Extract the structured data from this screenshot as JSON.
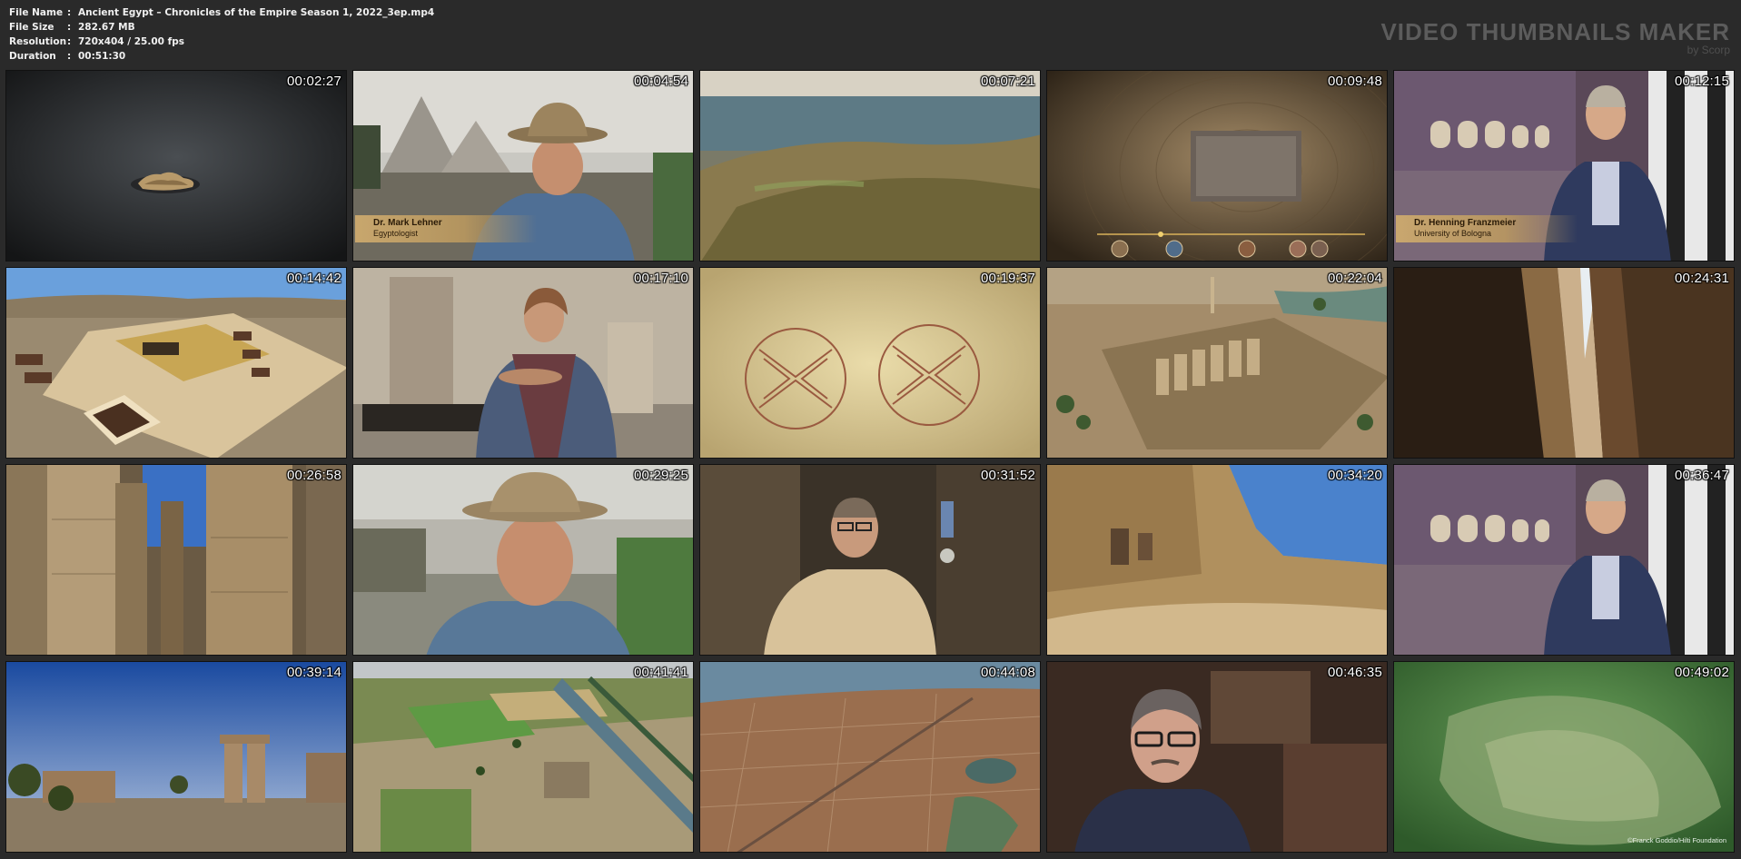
{
  "file_info": [
    {
      "key": "File Name",
      "sep": ":",
      "value": "Ancient Egypt – Chronicles of the Empire Season 1, 2022_3ep.mp4"
    },
    {
      "key": "File Size",
      "sep": ":",
      "value": "282.67 MB"
    },
    {
      "key": "Resolution",
      "sep": ":",
      "value": "720x404 / 25.00 fps"
    },
    {
      "key": "Duration",
      "sep": ":",
      "value": "00:51:30"
    }
  ],
  "brand": {
    "title": "VIDEO THUMBNAILS MAKER",
    "subtitle": "by Scorp"
  },
  "thumbnails": [
    {
      "time": "00:02:27",
      "scene": "rock-island-in-dark-sea"
    },
    {
      "time": "00:04:54",
      "scene": "interview-pyramids",
      "caption_name": "Dr. Mark Lehner",
      "caption_role": "Egyptologist"
    },
    {
      "time": "00:07:21",
      "scene": "aerial-delta-coast"
    },
    {
      "time": "00:09:48",
      "scene": "stone-relief-timeline"
    },
    {
      "time": "00:12:15",
      "scene": "interview-museum",
      "caption_name": "Dr. Henning Franzmeier",
      "caption_role": "University of Bologna"
    },
    {
      "time": "00:14:42",
      "scene": "3d-tomb-reconstruction"
    },
    {
      "time": "00:17:10",
      "scene": "interview-woman-museum"
    },
    {
      "time": "00:19:37",
      "scene": "papyrus-symbols"
    },
    {
      "time": "00:22:04",
      "scene": "aerial-karnak"
    },
    {
      "time": "00:24:31",
      "scene": "canyon-cliffs"
    },
    {
      "time": "00:26:58",
      "scene": "hypostyle-columns"
    },
    {
      "time": "00:29:25",
      "scene": "interview-hat-closeup"
    },
    {
      "time": "00:31:52",
      "scene": "interview-glasses-man"
    },
    {
      "time": "00:34:20",
      "scene": "desert-rock-tombs"
    },
    {
      "time": "00:36:47",
      "scene": "interview-museum-2"
    },
    {
      "time": "00:39:14",
      "scene": "temple-ruins-sky"
    },
    {
      "time": "00:41:41",
      "scene": "aerial-fields-canal"
    },
    {
      "time": "00:44:08",
      "scene": "aerial-city-sea"
    },
    {
      "time": "00:46:35",
      "scene": "interview-dark-man"
    },
    {
      "time": "00:49:02",
      "scene": "underwater-stone",
      "credit": "©Franck Goddio/Hilti Foundation"
    }
  ]
}
